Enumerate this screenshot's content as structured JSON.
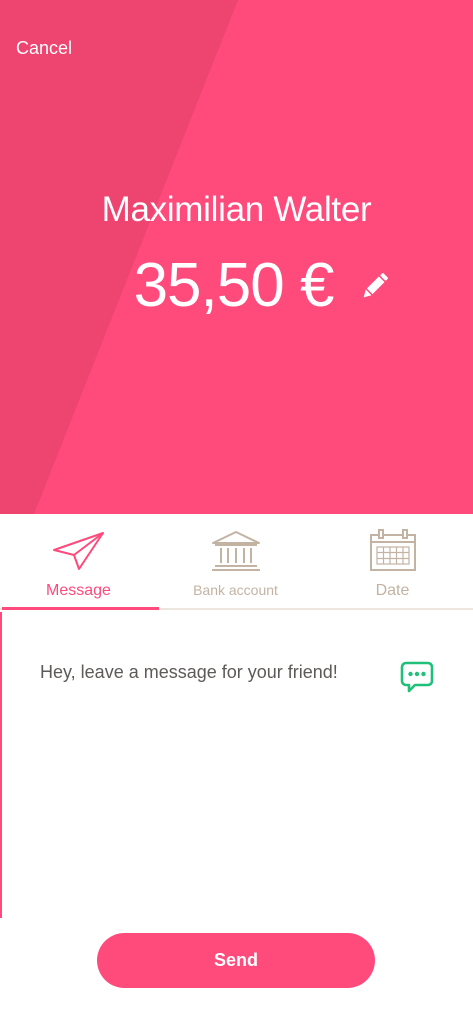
{
  "header": {
    "cancel_label": "Cancel",
    "recipient_name": "Maximilian Walter",
    "amount": "35,50 €",
    "edit_icon": "pencil-icon"
  },
  "tabs": [
    {
      "label": "Message",
      "icon": "paper-plane-icon",
      "active": true
    },
    {
      "label": "Bank account",
      "icon": "bank-icon",
      "active": false
    },
    {
      "label": "Date",
      "icon": "calendar-icon",
      "active": false
    }
  ],
  "message": {
    "placeholder": "Hey, leave a message for your friend!",
    "value": "",
    "icon": "chat-bubble-icon"
  },
  "footer": {
    "send_label": "Send"
  },
  "colors": {
    "accent": "#ff4a7c",
    "accent_shade": "#ee4470",
    "inactive": "#c2b3a3",
    "chat_icon": "#1fc07a"
  }
}
